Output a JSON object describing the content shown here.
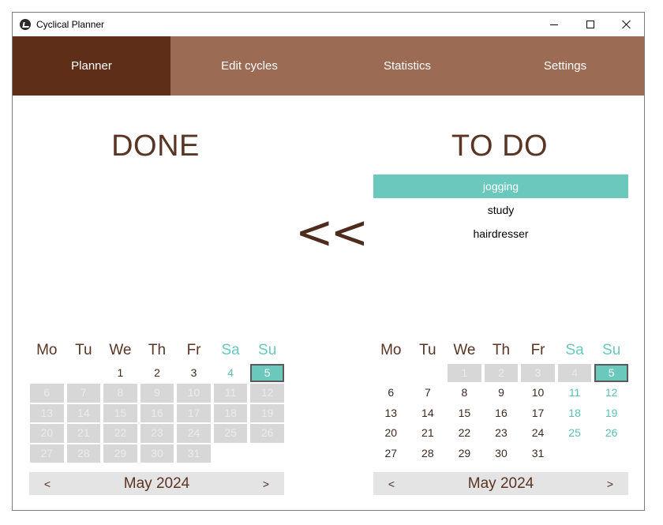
{
  "window": {
    "title": "Cyclical Planner"
  },
  "tabs": [
    {
      "label": "Planner",
      "active": true
    },
    {
      "label": "Edit cycles",
      "active": false
    },
    {
      "label": "Statistics",
      "active": false
    },
    {
      "label": "Settings",
      "active": false
    }
  ],
  "done": {
    "heading": "DONE"
  },
  "todo": {
    "heading": "TO DO",
    "items": [
      {
        "label": "jogging",
        "selected": true
      },
      {
        "label": "study",
        "selected": false
      },
      {
        "label": "hairdresser",
        "selected": false
      }
    ]
  },
  "transfer": {
    "label": "<<"
  },
  "colors": {
    "tab_active": "#5e2e18",
    "tab": "#9c6b54",
    "accent": "#6ac8bc",
    "text_brown": "#5a3424"
  },
  "calendars": {
    "weekdays": [
      "Mo",
      "Tu",
      "We",
      "Th",
      "Fr",
      "Sa",
      "Su"
    ],
    "left": {
      "month_label": "May 2024",
      "prev_label": "<",
      "next_label": ">",
      "weeks": [
        [
          "",
          "",
          "1",
          "2",
          "3",
          "4",
          "5"
        ],
        [
          "6",
          "7",
          "8",
          "9",
          "10",
          "11",
          "12"
        ],
        [
          "13",
          "14",
          "15",
          "16",
          "17",
          "18",
          "19"
        ],
        [
          "20",
          "21",
          "22",
          "23",
          "24",
          "25",
          "26"
        ],
        [
          "27",
          "28",
          "29",
          "30",
          "31",
          "",
          ""
        ]
      ],
      "enabled_days": [
        "1",
        "2",
        "3",
        "4",
        "5"
      ],
      "today": "5"
    },
    "right": {
      "month_label": "May 2024",
      "prev_label": "<",
      "next_label": ">",
      "weeks": [
        [
          "",
          "",
          "1",
          "2",
          "3",
          "4",
          "5"
        ],
        [
          "6",
          "7",
          "8",
          "9",
          "10",
          "11",
          "12"
        ],
        [
          "13",
          "14",
          "15",
          "16",
          "17",
          "18",
          "19"
        ],
        [
          "20",
          "21",
          "22",
          "23",
          "24",
          "25",
          "26"
        ],
        [
          "27",
          "28",
          "29",
          "30",
          "31",
          "",
          ""
        ]
      ],
      "disabled_days": [
        "1",
        "2",
        "3",
        "4"
      ],
      "today": "5"
    }
  }
}
